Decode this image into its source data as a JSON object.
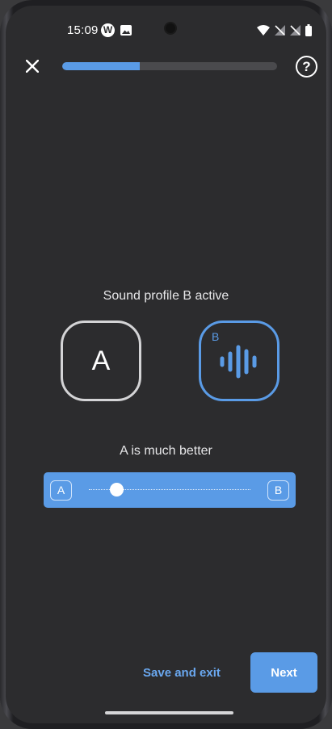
{
  "status_bar": {
    "time": "15:09",
    "app_icon_letter": "W"
  },
  "header": {
    "progress_fraction": 0.36,
    "help_glyph": "?"
  },
  "comparison": {
    "active_profile_text": "Sound profile B active",
    "profile_a_label": "A",
    "profile_b_label": "B",
    "preference_text": "A is much better",
    "slider_value_fraction": 0.17,
    "slider_left_label": "A",
    "slider_right_label": "B"
  },
  "footer": {
    "save_exit_label": "Save and exit",
    "next_label": "Next"
  },
  "colors": {
    "accent": "#5a9be6",
    "background": "#2c2c2e"
  }
}
